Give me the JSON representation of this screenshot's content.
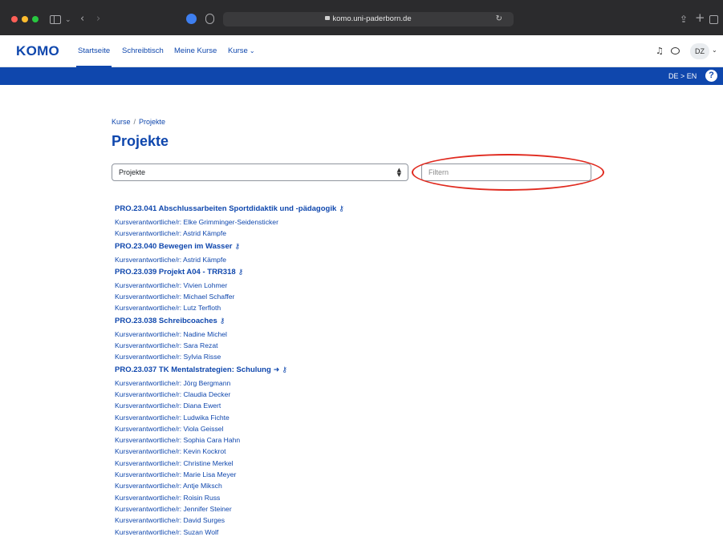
{
  "browser": {
    "url": "komo.uni-paderborn.de",
    "icons": [
      "sidebar-icon",
      "chevron-down-icon",
      "back-icon",
      "forward-icon",
      "extension-icon",
      "privacy-icon",
      "reload-icon",
      "share-icon",
      "new-tab-icon",
      "tabs-overview-icon"
    ]
  },
  "navbar": {
    "brand": "KOMO",
    "links": [
      "Startseite",
      "Schreibtisch",
      "Meine Kurse",
      "Kurse"
    ],
    "active_link": "Startseite",
    "avatar_initials": "DZ"
  },
  "blueband": {
    "language_switch": "DE > EN",
    "help": "?"
  },
  "main": {
    "breadcrumb": [
      "Kurse",
      "Projekte"
    ],
    "title": "Projekte",
    "category_select_value": "Projekte",
    "filter_placeholder": "Filtern",
    "teacher_label": "Kursverantwortliche/r: ",
    "courses": [
      {
        "title": "PRO.23.041 Abschlussarbeiten Sportdidaktik und -pädagogik",
        "icons": [
          "key-icon"
        ],
        "teachers": [
          "Elke Grimminger-Seidensticker",
          "Astrid Kämpfe"
        ]
      },
      {
        "title": "PRO.23.040 Bewegen im Wasser",
        "icons": [
          "key-icon"
        ],
        "teachers": [
          "Astrid Kämpfe"
        ]
      },
      {
        "title": "PRO.23.039 Projekt A04 - TRR318",
        "icons": [
          "key-icon"
        ],
        "teachers": [
          "Vivien Lohmer",
          "Michael Schaffer",
          "Lutz Terfloth"
        ]
      },
      {
        "title": "PRO.23.038 Schreibcoaches",
        "icons": [
          "key-icon"
        ],
        "teachers": [
          "Nadine Michel",
          "Sara Rezat",
          "Sylvia Risse"
        ]
      },
      {
        "title": "PRO.23.037 TK Mentalstrategien: Schulung",
        "icons": [
          "self-enrol-icon",
          "key-icon"
        ],
        "teachers": [
          "Jörg Bergmann",
          "Claudia Decker",
          "Diana Ewert",
          "Ludwika Fichte",
          "Viola Geissel",
          "Sophia Cara Hahn",
          "Kevin Kockrot",
          "Christine Merkel",
          "Marie Lisa Meyer",
          "Antje Miksch",
          "Roisin Russ",
          "Jennifer Steiner",
          "David Surges",
          "Suzan Wolf"
        ]
      }
    ]
  },
  "colors": {
    "brand_blue": "#0f47ad",
    "annotation_red": "#e02a1f"
  }
}
